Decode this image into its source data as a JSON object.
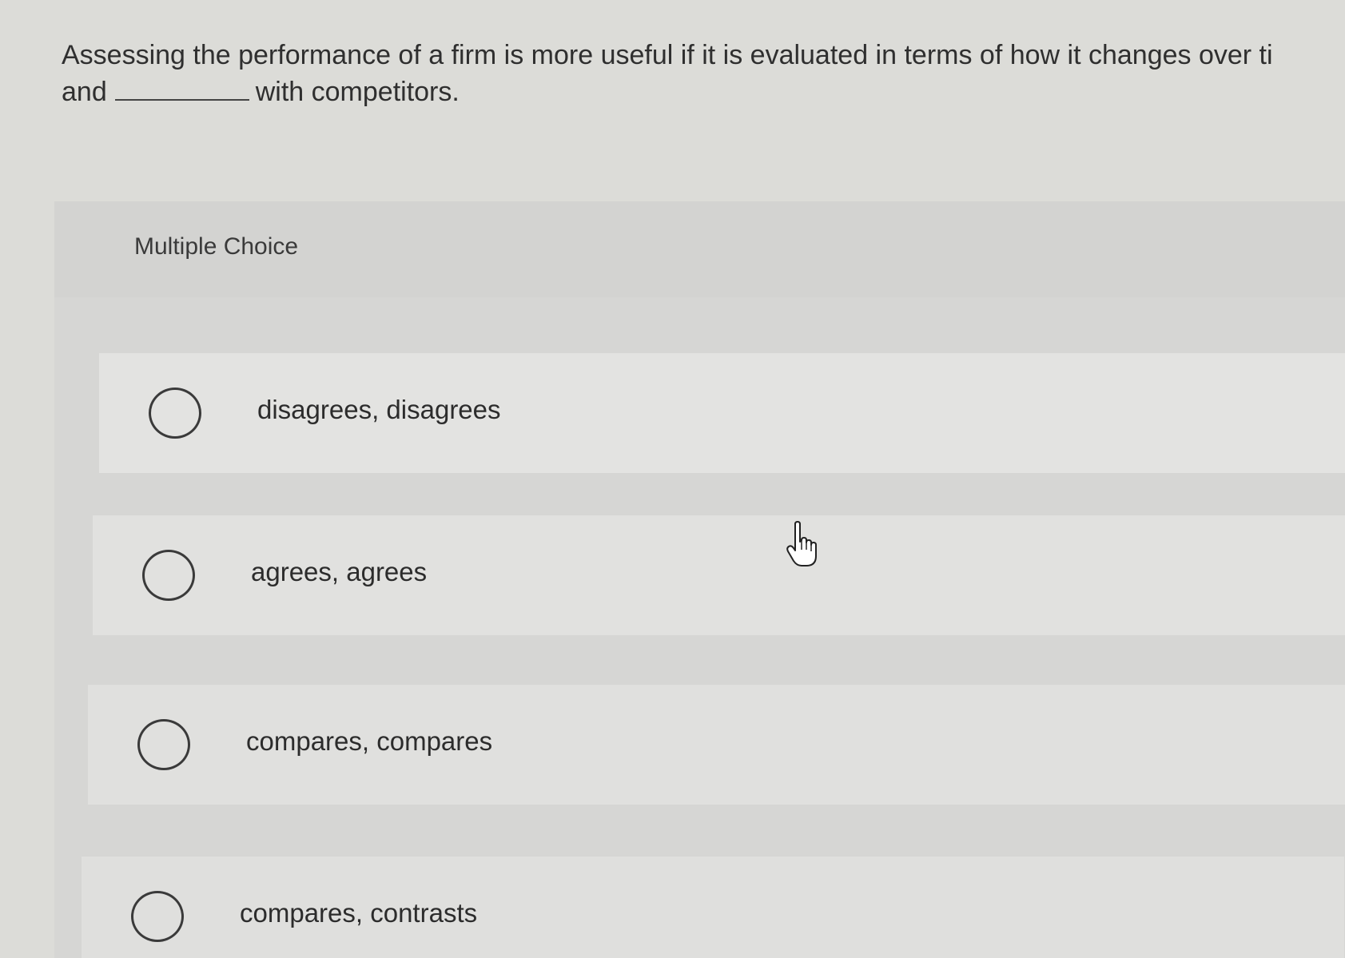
{
  "question": {
    "text_before": "Assessing the performance of a firm is more useful if it is evaluated in terms of how it changes over ti",
    "text_line2_start": "and",
    "text_after": "with competitors."
  },
  "panel": {
    "title": "Multiple Choice"
  },
  "options": [
    {
      "label": "disagrees, disagrees"
    },
    {
      "label": "agrees, agrees"
    },
    {
      "label": "compares, compares"
    },
    {
      "label": "compares, contrasts"
    }
  ],
  "cursor": {
    "icon": "hand-pointer-icon"
  }
}
